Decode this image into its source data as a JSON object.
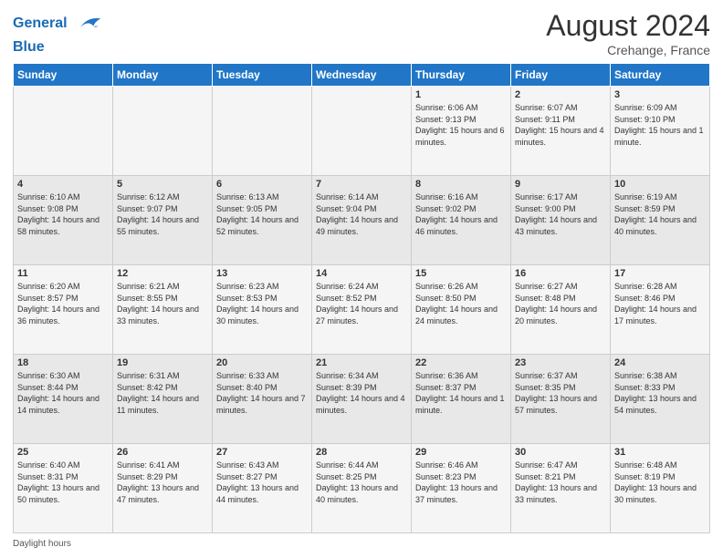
{
  "header": {
    "logo_line1": "General",
    "logo_line2": "Blue",
    "month_year": "August 2024",
    "location": "Crehange, France"
  },
  "days_of_week": [
    "Sunday",
    "Monday",
    "Tuesday",
    "Wednesday",
    "Thursday",
    "Friday",
    "Saturday"
  ],
  "weeks": [
    [
      {
        "day": "",
        "sunrise": "",
        "sunset": "",
        "daylight": ""
      },
      {
        "day": "",
        "sunrise": "",
        "sunset": "",
        "daylight": ""
      },
      {
        "day": "",
        "sunrise": "",
        "sunset": "",
        "daylight": ""
      },
      {
        "day": "",
        "sunrise": "",
        "sunset": "",
        "daylight": ""
      },
      {
        "day": "1",
        "sunrise": "Sunrise: 6:06 AM",
        "sunset": "Sunset: 9:13 PM",
        "daylight": "Daylight: 15 hours and 6 minutes."
      },
      {
        "day": "2",
        "sunrise": "Sunrise: 6:07 AM",
        "sunset": "Sunset: 9:11 PM",
        "daylight": "Daylight: 15 hours and 4 minutes."
      },
      {
        "day": "3",
        "sunrise": "Sunrise: 6:09 AM",
        "sunset": "Sunset: 9:10 PM",
        "daylight": "Daylight: 15 hours and 1 minute."
      }
    ],
    [
      {
        "day": "4",
        "sunrise": "Sunrise: 6:10 AM",
        "sunset": "Sunset: 9:08 PM",
        "daylight": "Daylight: 14 hours and 58 minutes."
      },
      {
        "day": "5",
        "sunrise": "Sunrise: 6:12 AM",
        "sunset": "Sunset: 9:07 PM",
        "daylight": "Daylight: 14 hours and 55 minutes."
      },
      {
        "day": "6",
        "sunrise": "Sunrise: 6:13 AM",
        "sunset": "Sunset: 9:05 PM",
        "daylight": "Daylight: 14 hours and 52 minutes."
      },
      {
        "day": "7",
        "sunrise": "Sunrise: 6:14 AM",
        "sunset": "Sunset: 9:04 PM",
        "daylight": "Daylight: 14 hours and 49 minutes."
      },
      {
        "day": "8",
        "sunrise": "Sunrise: 6:16 AM",
        "sunset": "Sunset: 9:02 PM",
        "daylight": "Daylight: 14 hours and 46 minutes."
      },
      {
        "day": "9",
        "sunrise": "Sunrise: 6:17 AM",
        "sunset": "Sunset: 9:00 PM",
        "daylight": "Daylight: 14 hours and 43 minutes."
      },
      {
        "day": "10",
        "sunrise": "Sunrise: 6:19 AM",
        "sunset": "Sunset: 8:59 PM",
        "daylight": "Daylight: 14 hours and 40 minutes."
      }
    ],
    [
      {
        "day": "11",
        "sunrise": "Sunrise: 6:20 AM",
        "sunset": "Sunset: 8:57 PM",
        "daylight": "Daylight: 14 hours and 36 minutes."
      },
      {
        "day": "12",
        "sunrise": "Sunrise: 6:21 AM",
        "sunset": "Sunset: 8:55 PM",
        "daylight": "Daylight: 14 hours and 33 minutes."
      },
      {
        "day": "13",
        "sunrise": "Sunrise: 6:23 AM",
        "sunset": "Sunset: 8:53 PM",
        "daylight": "Daylight: 14 hours and 30 minutes."
      },
      {
        "day": "14",
        "sunrise": "Sunrise: 6:24 AM",
        "sunset": "Sunset: 8:52 PM",
        "daylight": "Daylight: 14 hours and 27 minutes."
      },
      {
        "day": "15",
        "sunrise": "Sunrise: 6:26 AM",
        "sunset": "Sunset: 8:50 PM",
        "daylight": "Daylight: 14 hours and 24 minutes."
      },
      {
        "day": "16",
        "sunrise": "Sunrise: 6:27 AM",
        "sunset": "Sunset: 8:48 PM",
        "daylight": "Daylight: 14 hours and 20 minutes."
      },
      {
        "day": "17",
        "sunrise": "Sunrise: 6:28 AM",
        "sunset": "Sunset: 8:46 PM",
        "daylight": "Daylight: 14 hours and 17 minutes."
      }
    ],
    [
      {
        "day": "18",
        "sunrise": "Sunrise: 6:30 AM",
        "sunset": "Sunset: 8:44 PM",
        "daylight": "Daylight: 14 hours and 14 minutes."
      },
      {
        "day": "19",
        "sunrise": "Sunrise: 6:31 AM",
        "sunset": "Sunset: 8:42 PM",
        "daylight": "Daylight: 14 hours and 11 minutes."
      },
      {
        "day": "20",
        "sunrise": "Sunrise: 6:33 AM",
        "sunset": "Sunset: 8:40 PM",
        "daylight": "Daylight: 14 hours and 7 minutes."
      },
      {
        "day": "21",
        "sunrise": "Sunrise: 6:34 AM",
        "sunset": "Sunset: 8:39 PM",
        "daylight": "Daylight: 14 hours and 4 minutes."
      },
      {
        "day": "22",
        "sunrise": "Sunrise: 6:36 AM",
        "sunset": "Sunset: 8:37 PM",
        "daylight": "Daylight: 14 hours and 1 minute."
      },
      {
        "day": "23",
        "sunrise": "Sunrise: 6:37 AM",
        "sunset": "Sunset: 8:35 PM",
        "daylight": "Daylight: 13 hours and 57 minutes."
      },
      {
        "day": "24",
        "sunrise": "Sunrise: 6:38 AM",
        "sunset": "Sunset: 8:33 PM",
        "daylight": "Daylight: 13 hours and 54 minutes."
      }
    ],
    [
      {
        "day": "25",
        "sunrise": "Sunrise: 6:40 AM",
        "sunset": "Sunset: 8:31 PM",
        "daylight": "Daylight: 13 hours and 50 minutes."
      },
      {
        "day": "26",
        "sunrise": "Sunrise: 6:41 AM",
        "sunset": "Sunset: 8:29 PM",
        "daylight": "Daylight: 13 hours and 47 minutes."
      },
      {
        "day": "27",
        "sunrise": "Sunrise: 6:43 AM",
        "sunset": "Sunset: 8:27 PM",
        "daylight": "Daylight: 13 hours and 44 minutes."
      },
      {
        "day": "28",
        "sunrise": "Sunrise: 6:44 AM",
        "sunset": "Sunset: 8:25 PM",
        "daylight": "Daylight: 13 hours and 40 minutes."
      },
      {
        "day": "29",
        "sunrise": "Sunrise: 6:46 AM",
        "sunset": "Sunset: 8:23 PM",
        "daylight": "Daylight: 13 hours and 37 minutes."
      },
      {
        "day": "30",
        "sunrise": "Sunrise: 6:47 AM",
        "sunset": "Sunset: 8:21 PM",
        "daylight": "Daylight: 13 hours and 33 minutes."
      },
      {
        "day": "31",
        "sunrise": "Sunrise: 6:48 AM",
        "sunset": "Sunset: 8:19 PM",
        "daylight": "Daylight: 13 hours and 30 minutes."
      }
    ]
  ],
  "footer": {
    "daylight_label": "Daylight hours"
  }
}
